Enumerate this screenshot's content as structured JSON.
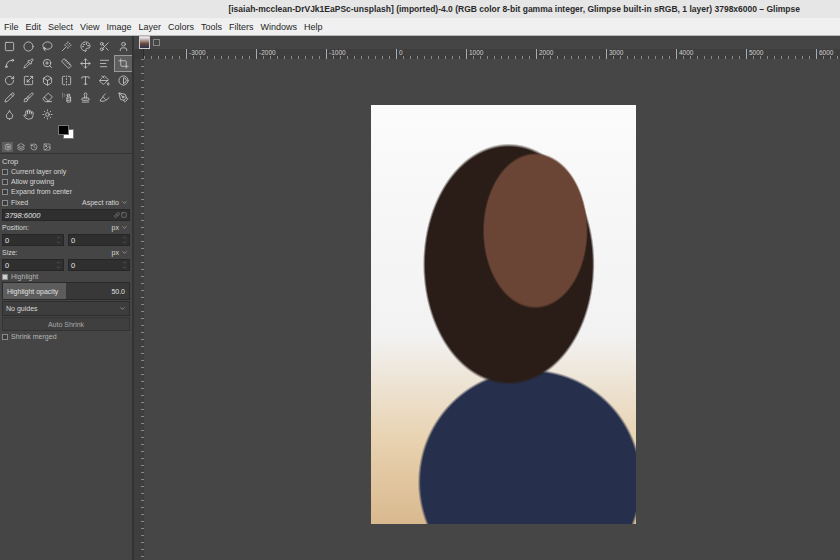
{
  "window": {
    "title": "[isaiah-mcclean-DrVJk1EaPSc-unsplash] (imported)-4.0 (RGB color 8-bit gamma integer, Glimpse built-in sRGB, 1 layer) 3798x6000 – Glimpse"
  },
  "menu": [
    "File",
    "Edit",
    "Select",
    "View",
    "Image",
    "Layer",
    "Colors",
    "Tools",
    "Filters",
    "Windows",
    "Help"
  ],
  "toolbox": {
    "tools": [
      {
        "selected": false
      },
      {
        "selected": false
      },
      {
        "selected": false
      },
      {
        "selected": false
      },
      {
        "selected": false
      },
      {
        "selected": false
      },
      {
        "selected": false
      },
      {
        "selected": false
      },
      {
        "selected": false
      },
      {
        "selected": false
      },
      {
        "selected": false
      },
      {
        "selected": false
      },
      {
        "selected": false
      },
      {
        "selected": true
      },
      {
        "selected": false
      },
      {
        "selected": false
      },
      {
        "selected": false
      },
      {
        "selected": false
      },
      {
        "selected": false
      },
      {
        "selected": false
      },
      {
        "selected": false
      },
      {
        "selected": false
      },
      {
        "selected": false
      },
      {
        "selected": false
      },
      {
        "selected": false
      },
      {
        "selected": false
      },
      {
        "selected": false
      },
      {
        "selected": false
      },
      {
        "selected": false
      },
      {
        "selected": false
      },
      {
        "selected": false
      }
    ]
  },
  "dock_tabs": [
    {
      "selected": true
    },
    {
      "selected": false
    },
    {
      "selected": false
    },
    {
      "selected": false
    }
  ],
  "tool_options": {
    "title": "Crop",
    "checkboxes": [
      {
        "label": "Current layer only",
        "checked": false
      },
      {
        "label": "Allow growing",
        "checked": false
      },
      {
        "label": "Expand from center",
        "checked": false
      }
    ],
    "fixed": {
      "label": "Fixed",
      "checked": false,
      "mode": "Aspect ratio",
      "value": "3798:6000"
    },
    "position": {
      "label": "Position:",
      "unit": "px",
      "x": "0",
      "y": "0"
    },
    "size": {
      "label": "Size:",
      "unit": "px",
      "width": "0",
      "height": "0"
    },
    "highlight": {
      "label": "Highlight",
      "checked": true
    },
    "highlight_opacity": {
      "label": "Highlight opacity",
      "level": 0.5,
      "reading": "50.0"
    },
    "guides": "No guides",
    "auto_shrink": "Auto Shrink",
    "shrink_merged": {
      "label": "Shrink merged",
      "checked": false
    }
  },
  "ruler": {
    "labels": [
      "-3000",
      "-2000",
      "-1000",
      "0",
      "1000",
      "2000",
      "3000",
      "4000",
      "5000",
      "6000"
    ]
  }
}
